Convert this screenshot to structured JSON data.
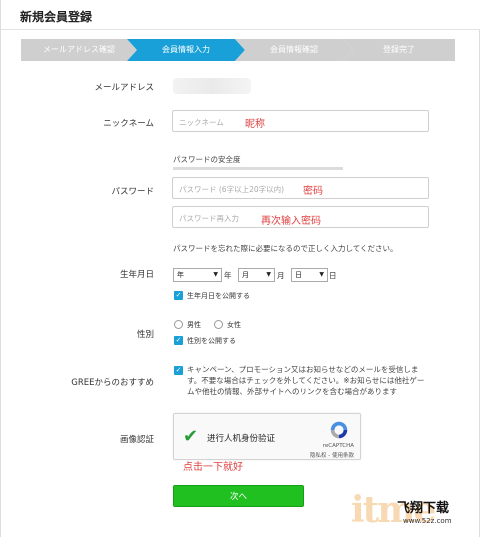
{
  "page": {
    "title": "新規会員登録"
  },
  "steps": [
    {
      "label": "メールアドレス確認",
      "state": "done"
    },
    {
      "label": "会員情報入力",
      "state": "active"
    },
    {
      "label": "会員情報確認",
      "state": "pending"
    },
    {
      "label": "登録完了",
      "state": "pending"
    }
  ],
  "colors": {
    "accent": "#1aa0d8",
    "step_inactive": "#cfcfcf",
    "button": "#20c020",
    "annotation": "#e04040"
  },
  "form": {
    "email": {
      "label": "メールアドレス"
    },
    "nickname": {
      "label": "ニックネーム",
      "placeholder": "ニックネーム",
      "annotation": "昵称"
    },
    "password": {
      "label": "パスワード",
      "strength_label": "パスワードの安全度",
      "placeholder": "パスワード (6字以上20字以内)",
      "annotation": "密码",
      "confirm_placeholder": "パスワード再入力",
      "confirm_annotation": "再次输入密码",
      "note": "パスワードを忘れた際に必要になるので正しく入力してください。"
    },
    "birthday": {
      "label": "生年月日",
      "year_value": "年",
      "year_unit": "年",
      "month_value": "月",
      "month_unit": "月",
      "day_value": "日",
      "day_unit": "日",
      "publish_label": "生年月日を公開する"
    },
    "gender": {
      "label": "性別",
      "male": "男性",
      "female": "女性",
      "publish_label": "性別を公開する"
    },
    "recommend": {
      "label": "GREEからのおすすめ",
      "text": "キャンペーン、プロモーション又はお知らせなどのメールを受信します。不要な場合はチェックを外してください。※お知らせには他社ゲームや他社の情報、外部サイトへのリンクを含む場合があります"
    },
    "captcha": {
      "label": "画像認証",
      "text": "进行人机身份验证",
      "brand": "reCAPTCHA",
      "links": "隐私权 - 使用条款",
      "annotation": "点击一下就好"
    },
    "submit_label": "次へ"
  },
  "watermark": {
    "big": "itme",
    "cn": "飞翔下载",
    "url": "www.52z.com"
  }
}
